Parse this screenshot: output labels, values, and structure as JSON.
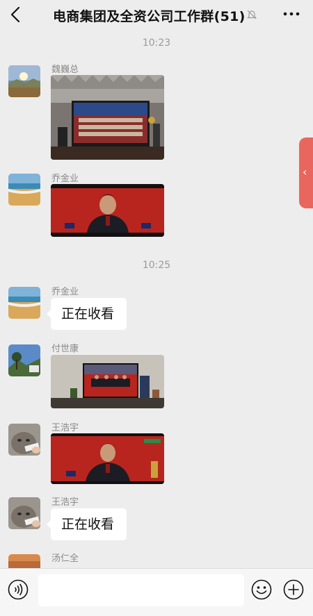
{
  "header": {
    "title": "电商集团及全资公司工作群(51)"
  },
  "timestamps": [
    "10:23",
    "10:25"
  ],
  "messages": [
    {
      "sender": "魏巍总",
      "type": "image",
      "avatar": "landscape-avatar"
    },
    {
      "sender": "乔金业",
      "type": "image",
      "avatar": "beach-avatar"
    },
    {
      "sender": "乔金业",
      "type": "text",
      "text": "正在收看",
      "avatar": "beach-avatar"
    },
    {
      "sender": "付世康",
      "type": "image",
      "avatar": "mountain-tree-avatar"
    },
    {
      "sender": "王浩宇",
      "type": "image",
      "avatar": "cat-avatar"
    },
    {
      "sender": "王浩宇",
      "type": "text",
      "text": "正在收看",
      "avatar": "cat-avatar"
    },
    {
      "sender": "汤仁全",
      "type": "partial",
      "avatar": "sunset-avatar"
    }
  ],
  "composer": {
    "placeholder": ""
  },
  "icons": {
    "back": "back-arrow-icon",
    "mute": "bell-muted-icon",
    "more": "more-dots-icon",
    "voice": "voice-icon",
    "emoji": "emoji-icon",
    "plus": "plus-icon",
    "side": "chevron-left-icon"
  },
  "colors": {
    "background": "#ededed",
    "bubble": "#ffffff",
    "side_tab": "#e9665f",
    "timestamp": "#9a9a9a",
    "sender": "#8a8a8a"
  }
}
